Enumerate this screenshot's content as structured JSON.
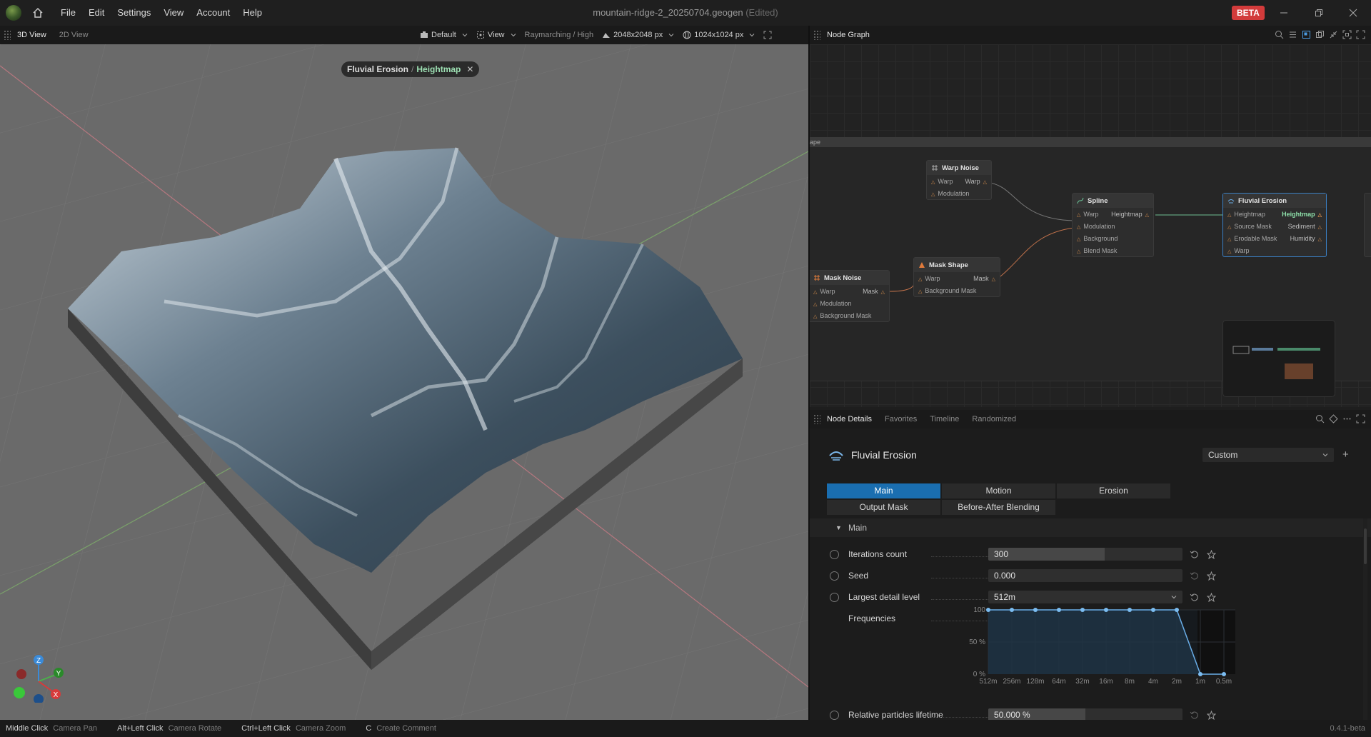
{
  "titlebar": {
    "menu": [
      "File",
      "Edit",
      "Settings",
      "View",
      "Account",
      "Help"
    ],
    "document": "mountain-ridge-2_20250704.geogen",
    "edited": "(Edited)",
    "badge": "BETA"
  },
  "viewport": {
    "tabs": [
      "3D View",
      "2D View"
    ],
    "render_preset": "Default",
    "view_menu": "View",
    "render_mode": "Raymarching / High",
    "resolution": "2048x2048 px",
    "preview_resolution": "1024x1024 px",
    "breadcrumb": {
      "node": "Fluvial Erosion",
      "sep": "/",
      "output": "Heightmap"
    },
    "axes": {
      "z": "Z",
      "y": "Y",
      "x": "X"
    }
  },
  "node_graph": {
    "title": "Node Graph",
    "frame_label": "ape",
    "nodes": {
      "warp_noise": {
        "title": "Warp Noise",
        "rows": [
          [
            "Warp",
            "Warp"
          ],
          [
            "Modulation",
            ""
          ]
        ]
      },
      "spline": {
        "title": "Spline",
        "rows": [
          [
            "Warp",
            "Heightmap"
          ],
          [
            "Modulation",
            ""
          ],
          [
            "Background",
            ""
          ],
          [
            "Blend Mask",
            ""
          ]
        ]
      },
      "fluvial": {
        "title": "Fluvial Erosion",
        "rows": [
          [
            "Heightmap",
            "Heightmap"
          ],
          [
            "Source Mask",
            "Sediment"
          ],
          [
            "Erodable Mask",
            "Humidity"
          ],
          [
            "Warp",
            ""
          ]
        ]
      },
      "mask_shape": {
        "title": "Mask Shape",
        "rows": [
          [
            "Warp",
            "Mask"
          ],
          [
            "Background Mask",
            ""
          ]
        ]
      },
      "mask_noise": {
        "title": "Mask Noise",
        "rows": [
          [
            "Warp",
            "Mask"
          ],
          [
            "Modulation",
            ""
          ],
          [
            "Background Mask",
            ""
          ]
        ]
      }
    }
  },
  "node_details": {
    "tabs": [
      "Node Details",
      "Favorites",
      "Timeline",
      "Randomized"
    ],
    "node_title": "Fluvial Erosion",
    "preset": "Custom",
    "param_tabs": [
      "Main",
      "Motion",
      "Erosion",
      "Output Mask",
      "Before-After Blending"
    ],
    "section": "Main",
    "params": {
      "iterations": {
        "label": "Iterations count",
        "value": "300",
        "fill": 0.6
      },
      "seed": {
        "label": "Seed",
        "value": "0.000"
      },
      "detail": {
        "label": "Largest detail level",
        "value": "512m"
      },
      "frequencies": {
        "label": "Frequencies"
      },
      "lifetime": {
        "label": "Relative particles lifetime",
        "value": "50.000 %",
        "fill": 0.5
      }
    }
  },
  "chart_data": {
    "type": "line",
    "categories": [
      "512m",
      "256m",
      "128m",
      "64m",
      "32m",
      "16m",
      "8m",
      "4m",
      "2m",
      "1m",
      "0.5m"
    ],
    "values": [
      100,
      100,
      100,
      100,
      100,
      100,
      100,
      100,
      100,
      0,
      0
    ],
    "yticks": [
      "100",
      "50 %",
      "0 %"
    ],
    "ylim": [
      0,
      100
    ]
  },
  "statusbar": {
    "items": [
      {
        "key": "Middle Click",
        "action": "Camera Pan"
      },
      {
        "key": "Alt+Left Click",
        "action": "Camera Rotate"
      },
      {
        "key": "Ctrl+Left Click",
        "action": "Camera Zoom"
      },
      {
        "key": "C",
        "action": "Create Comment"
      }
    ],
    "version": "0.4.1-beta"
  }
}
